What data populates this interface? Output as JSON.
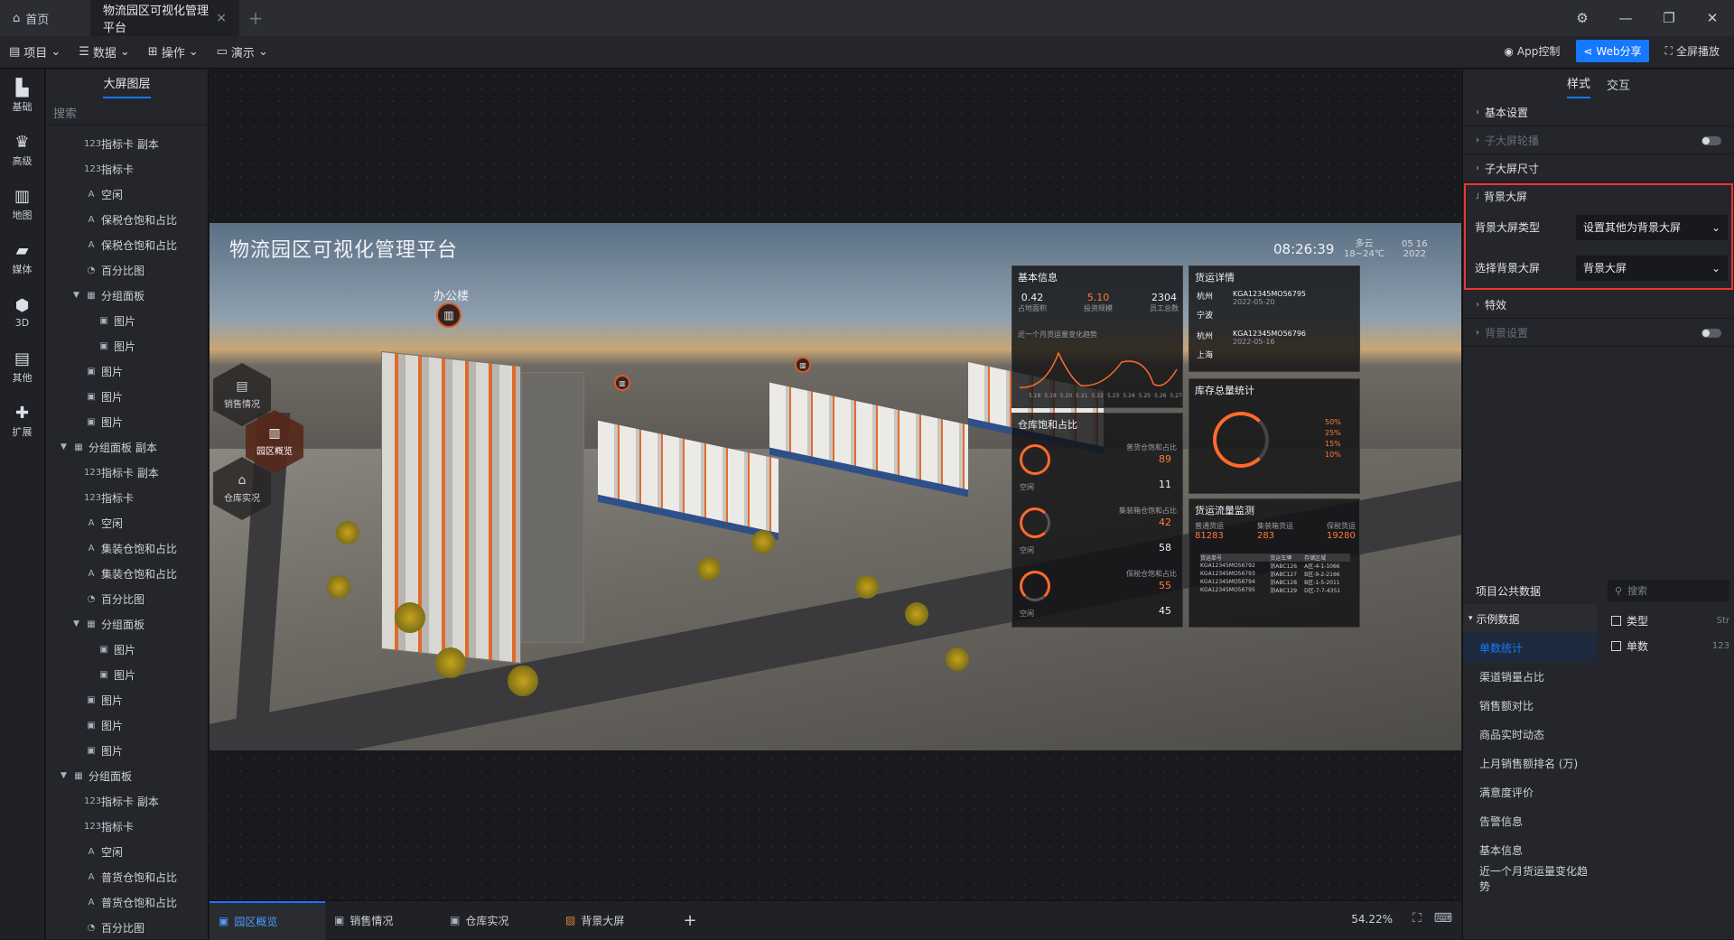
{
  "titlebar": {
    "home_tab": "首页",
    "active_tab": "物流园区可视化管理平台",
    "close_glyph": "×",
    "add_glyph": "+"
  },
  "toolbar": {
    "menus": [
      "项目",
      "数据",
      "操作",
      "演示"
    ],
    "app_control": "App控制",
    "web_share": "Web分享",
    "fullscreen": "全屏播放"
  },
  "rail": [
    "基础",
    "高级",
    "地图",
    "媒体",
    "3D",
    "其他",
    "扩展"
  ],
  "layers": {
    "tab": "大屏图层",
    "search_placeholder": "搜索",
    "items": [
      {
        "label": "指标卡 副本",
        "icon": "123",
        "indent": 1
      },
      {
        "label": "指标卡",
        "icon": "123",
        "indent": 1
      },
      {
        "label": "空闲",
        "icon": "A",
        "indent": 1
      },
      {
        "label": "保税仓饱和占比",
        "icon": "A",
        "indent": 1
      },
      {
        "label": "保税仓饱和占比",
        "icon": "A",
        "indent": 1
      },
      {
        "label": "百分比图",
        "icon": "◔",
        "indent": 1
      },
      {
        "label": "分组面板",
        "icon": "▦",
        "indent": 1,
        "caret": "▼"
      },
      {
        "label": "图片",
        "icon": "▣",
        "indent": 2
      },
      {
        "label": "图片",
        "icon": "▣",
        "indent": 2
      },
      {
        "label": "图片",
        "icon": "▣",
        "indent": 1
      },
      {
        "label": "图片",
        "icon": "▣",
        "indent": 1
      },
      {
        "label": "图片",
        "icon": "▣",
        "indent": 1
      },
      {
        "label": "分组面板 副本",
        "icon": "▦",
        "indent": 0,
        "caret": "▼"
      },
      {
        "label": "指标卡 副本",
        "icon": "123",
        "indent": 1
      },
      {
        "label": "指标卡",
        "icon": "123",
        "indent": 1
      },
      {
        "label": "空闲",
        "icon": "A",
        "indent": 1
      },
      {
        "label": "集装仓饱和占比",
        "icon": "A",
        "indent": 1
      },
      {
        "label": "集装仓饱和占比",
        "icon": "A",
        "indent": 1
      },
      {
        "label": "百分比图",
        "icon": "◔",
        "indent": 1
      },
      {
        "label": "分组面板",
        "icon": "▦",
        "indent": 1,
        "caret": "▼"
      },
      {
        "label": "图片",
        "icon": "▣",
        "indent": 2
      },
      {
        "label": "图片",
        "icon": "▣",
        "indent": 2
      },
      {
        "label": "图片",
        "icon": "▣",
        "indent": 1
      },
      {
        "label": "图片",
        "icon": "▣",
        "indent": 1
      },
      {
        "label": "图片",
        "icon": "▣",
        "indent": 1
      },
      {
        "label": "分组面板",
        "icon": "▦",
        "indent": 0,
        "caret": "▼"
      },
      {
        "label": "指标卡 副本",
        "icon": "123",
        "indent": 1
      },
      {
        "label": "指标卡",
        "icon": "123",
        "indent": 1
      },
      {
        "label": "空闲",
        "icon": "A",
        "indent": 1
      },
      {
        "label": "普货仓饱和占比",
        "icon": "A",
        "indent": 1
      },
      {
        "label": "普货仓饱和占比",
        "icon": "A",
        "indent": 1
      },
      {
        "label": "百分比图",
        "icon": "◔",
        "indent": 1
      }
    ]
  },
  "scene": {
    "title": "物流园区可视化管理平台",
    "time": "08:26:39",
    "weather_top": "多云",
    "weather_bottom": "18~24℃",
    "date_top": "05 16",
    "date_bottom": "2022",
    "building_label": "办公楼",
    "hex_nav": [
      "销售情况",
      "园区概览",
      "仓库实况"
    ],
    "basic_info": {
      "title": "基本信息",
      "stats": [
        {
          "value": "0.42",
          "label": "占地面积"
        },
        {
          "value": "5.10",
          "label": "投资规模"
        },
        {
          "value": "2304",
          "label": "员工总数"
        }
      ],
      "trend_label": "近一个月货运量变化趋势",
      "x_ticks": [
        "5.18",
        "5.19",
        "5.20",
        "5.21",
        "5.22",
        "5.23",
        "5.24",
        "5.25",
        "5.26",
        "5.27"
      ]
    },
    "freight": {
      "title": "货运详情",
      "rows": [
        {
          "from": "杭州",
          "to": "宁波",
          "code": "KGA12345MO56795",
          "date": "2022-05-20"
        },
        {
          "from": "杭州",
          "to": "上海",
          "code": "KGA12345MO56796",
          "date": "2022-05-16"
        }
      ]
    },
    "warehouse_ratio": {
      "title": "仓库饱和占比",
      "items": [
        {
          "name": "普货仓饱和占比",
          "pct": "89",
          "free_label": "空闲",
          "free": "11"
        },
        {
          "name": "集装箱仓饱和占比",
          "pct": "42",
          "free_label": "空闲",
          "free": "58"
        },
        {
          "name": "保税仓饱和占比",
          "pct": "55",
          "free_label": "空闲",
          "free": "45"
        }
      ]
    },
    "inventory": {
      "title": "库存总量统计",
      "legend": [
        "50%",
        "25%",
        "15%",
        "10%"
      ]
    },
    "flow": {
      "title": "货运流量监测",
      "stats": [
        {
          "value": "81283",
          "label": "普通货运"
        },
        {
          "value": "283",
          "label": "集装箱货运"
        },
        {
          "value": "19280",
          "label": "保税货运"
        }
      ],
      "headers": [
        "货运单号",
        "货运车牌",
        "存储区域"
      ],
      "rows": [
        [
          "KGA12345MO56792",
          "浙ABC126",
          "A区-4-1-1066"
        ],
        [
          "KGA12345MO56793",
          "浙ABC127",
          "B区-9-2-2166"
        ],
        [
          "KGA12345MO56794",
          "浙ABC128",
          "B区-1-5-2011"
        ],
        [
          "KGA12345MO56795",
          "浙ABC129",
          "D区-7-7-4351"
        ]
      ]
    }
  },
  "bottom": {
    "tabs": [
      "园区概览",
      "销售情况",
      "仓库实况",
      "背景大屏"
    ],
    "zoom": "54.22%"
  },
  "right": {
    "tabs": [
      "样式",
      "交互"
    ],
    "sections": {
      "basic": "基本设置",
      "carousel": "子大屏轮播",
      "size": "子大屏尺寸",
      "bg": "背景大屏",
      "bg_type_label": "背景大屏类型",
      "bg_type_value": "设置其他为背景大屏",
      "bg_select_label": "选择背景大屏",
      "bg_select_value": "背景大屏",
      "effects": "特效",
      "bg_settings": "背景设置"
    },
    "public_data": {
      "title": "项目公共数据",
      "search_placeholder": "搜索",
      "group": "示例数据",
      "items": [
        "单数统计",
        "渠道销量占比",
        "销售额对比",
        "商品实时动态",
        "上月销售额排名 (万)",
        "满意度评价",
        "告警信息",
        "基本信息",
        "近一个月货运量变化趋势"
      ],
      "fields": [
        {
          "name": "类型",
          "type": "Str"
        },
        {
          "name": "单数",
          "type": "123"
        }
      ]
    }
  },
  "colors": {
    "accent": "#1677ff",
    "orange": "#ff7a3d",
    "highlight_border": "#ee3333"
  }
}
